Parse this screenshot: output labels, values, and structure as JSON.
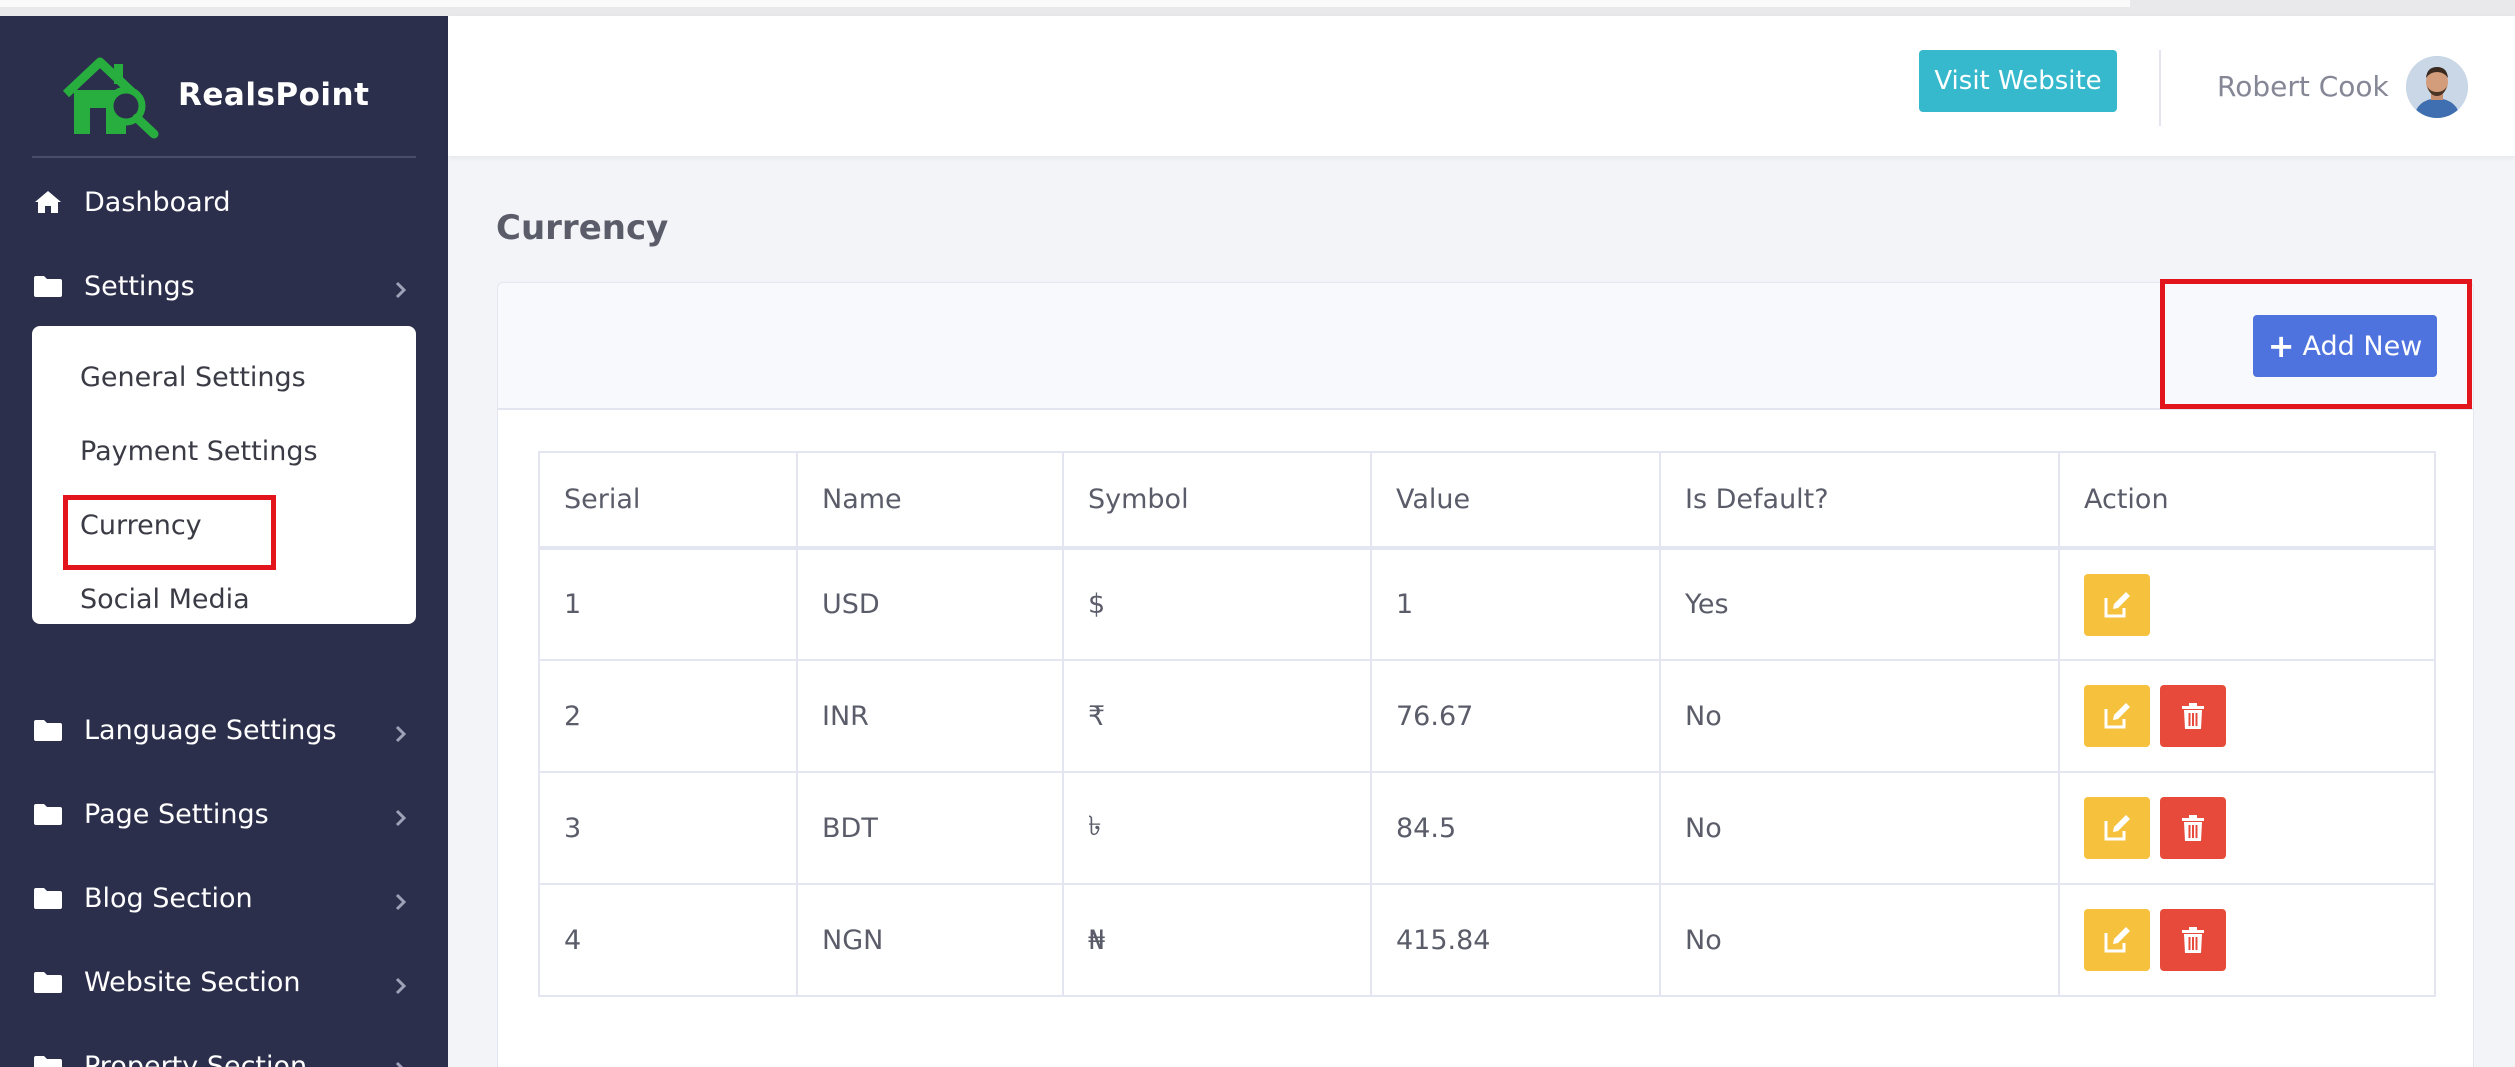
{
  "brand": {
    "name": "RealsPoint"
  },
  "sidebar": {
    "items": [
      {
        "label": "Dashboard",
        "icon": "home-icon"
      },
      {
        "label": "Settings",
        "icon": "folder-icon"
      },
      {
        "label": "Language Settings",
        "icon": "folder-icon"
      },
      {
        "label": "Page Settings",
        "icon": "folder-icon"
      },
      {
        "label": "Blog Section",
        "icon": "folder-icon"
      },
      {
        "label": "Website Section",
        "icon": "folder-icon"
      },
      {
        "label": "Property Section",
        "icon": "folder-icon"
      }
    ],
    "settings_submenu": [
      "General Settings",
      "Payment Settings",
      "Currency",
      "Social Media"
    ]
  },
  "header": {
    "visit_button": "Visit Website",
    "user_name": "Robert Cook"
  },
  "page": {
    "title": "Currency"
  },
  "card": {
    "add_button": "Add New"
  },
  "table": {
    "columns": [
      "Serial",
      "Name",
      "Symbol",
      "Value",
      "Is Default?",
      "Action"
    ],
    "rows": [
      {
        "serial": "1",
        "name": "USD",
        "symbol": "$",
        "value": "1",
        "is_default": "Yes",
        "deletable": false
      },
      {
        "serial": "2",
        "name": "INR",
        "symbol": "₹",
        "value": "76.67",
        "is_default": "No",
        "deletable": true
      },
      {
        "serial": "3",
        "name": "BDT",
        "symbol": "৳",
        "value": "84.5",
        "is_default": "No",
        "deletable": true
      },
      {
        "serial": "4",
        "name": "NGN",
        "symbol": "₦",
        "value": "415.84",
        "is_default": "No",
        "deletable": true
      }
    ]
  },
  "colors": {
    "sidebar_bg": "#2c2f4c",
    "brand_green": "#27ae3f",
    "visit_button": "#36b9cc",
    "add_button": "#4e73df",
    "edit_button": "#f6c23e",
    "delete_button": "#e74a3b",
    "highlight": "#e2151c"
  }
}
